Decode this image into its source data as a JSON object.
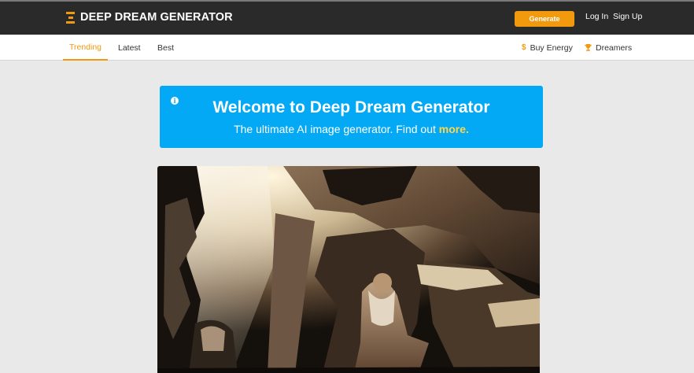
{
  "header": {
    "logo_text": "DEEP DREAM GENERATOR",
    "generate_label": "Generate",
    "login_label": "Log In",
    "signup_label": "Sign Up"
  },
  "subnav": {
    "tabs": [
      {
        "label": "Trending",
        "active": true
      },
      {
        "label": "Latest",
        "active": false
      },
      {
        "label": "Best",
        "active": false
      }
    ],
    "buy_energy_label": "Buy Energy",
    "dreamers_label": "Dreamers"
  },
  "banner": {
    "title": "Welcome to Deep Dream Generator",
    "subtitle_prefix": "The ultimate AI image generator. Find out ",
    "more_link": "more."
  },
  "colors": {
    "accent": "#f29a0e",
    "banner_bg": "#03a9f4",
    "topbar_bg": "#2a2a2a",
    "page_bg": "#e9e9e9",
    "more_link": "#ffd54a"
  },
  "icons": {
    "logo": "dream-logo-icon",
    "info": "info-icon",
    "energy": "dollar-icon",
    "dreamers": "trophy-icon"
  }
}
